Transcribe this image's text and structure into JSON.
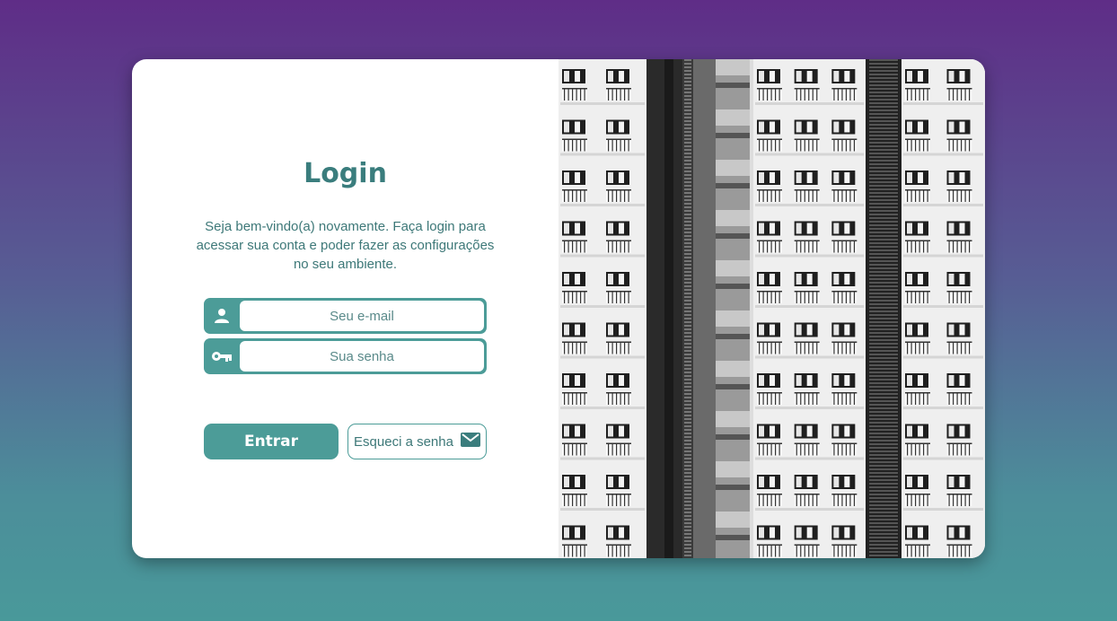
{
  "login": {
    "title": "Login",
    "welcome": "Seja bem-vindo(a) novamente. Faça login para acessar sua conta e poder fazer as configurações no seu ambiente.",
    "email_placeholder": "Seu e-mail",
    "password_placeholder": "Sua senha",
    "submit_label": "Entrar",
    "forgot_label": "Esqueci a senha"
  },
  "icons": {
    "email_field": "user-icon",
    "password_field": "key-icon",
    "forgot": "envelope-icon"
  },
  "colors": {
    "accent": "#4c9c98",
    "title": "#3a7d7d",
    "text": "#3d7878",
    "bg_top": "#5f2d87",
    "bg_bottom": "#49999a"
  },
  "image": {
    "subject": "black-and-white apartment building facade"
  }
}
